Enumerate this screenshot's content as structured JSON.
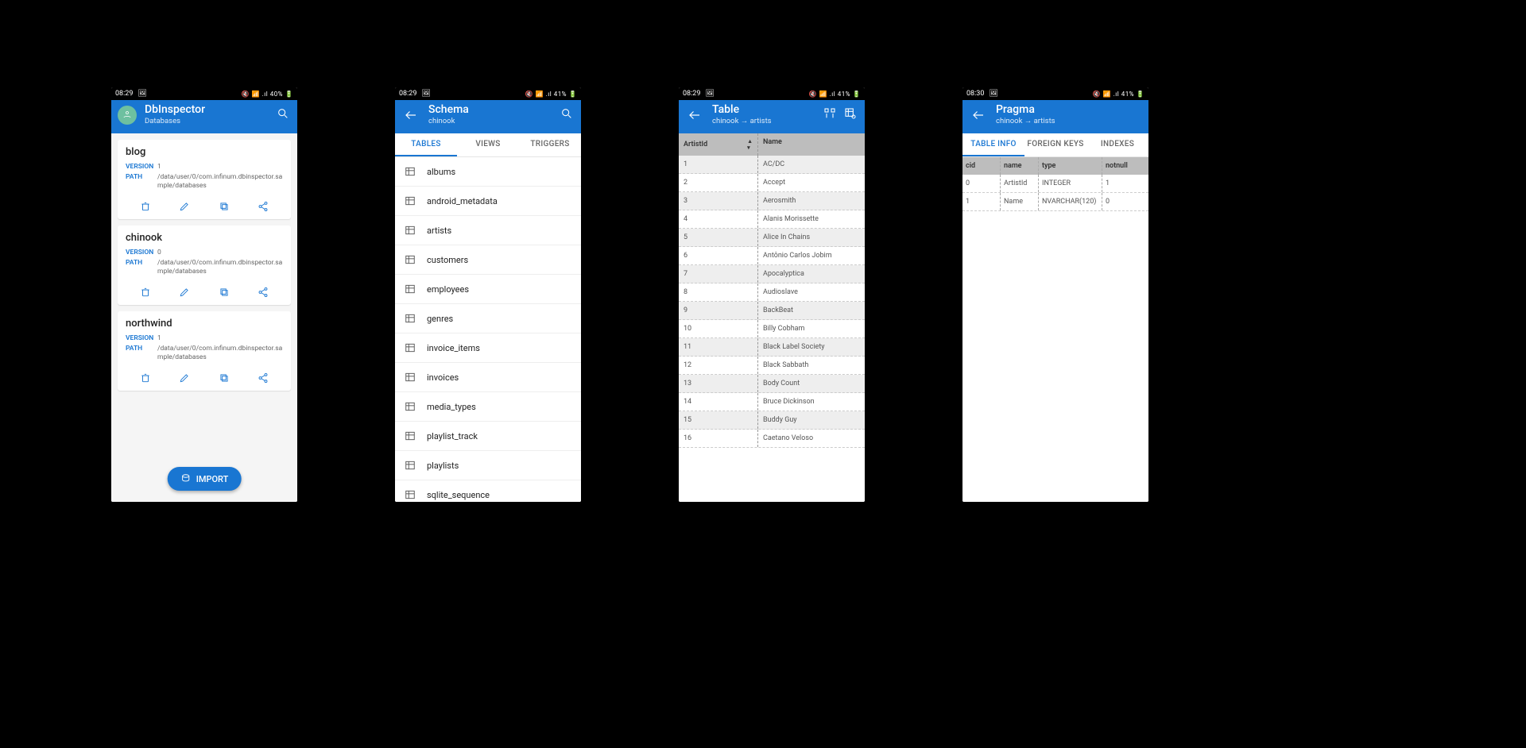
{
  "screens": {
    "s1": {
      "status": {
        "time": "08:29",
        "right": "🔇 📶 .ıl 40% 🔋"
      },
      "appbar": {
        "title": "DbInspector",
        "subtitle": "Databases"
      },
      "databases": [
        {
          "name": "blog",
          "version": [
            "VERSION",
            "1"
          ],
          "path": [
            "PATH",
            "/data/user/0/com.infinum.dbinspector.sample/databases"
          ]
        },
        {
          "name": "chinook",
          "version": [
            "VERSION",
            "0"
          ],
          "path": [
            "PATH",
            "/data/user/0/com.infinum.dbinspector.sample/databases"
          ]
        },
        {
          "name": "northwind",
          "version": [
            "VERSION",
            "1"
          ],
          "path": [
            "PATH",
            "/data/user/0/com.infinum.dbinspector.sample/databases"
          ]
        }
      ],
      "fab": "IMPORT"
    },
    "s2": {
      "status": {
        "time": "08:29",
        "right": "🔇 📶 .ıl 41% 🔋"
      },
      "appbar": {
        "title": "Schema",
        "subtitle": "chinook"
      },
      "tabs": [
        "TABLES",
        "VIEWS",
        "TRIGGERS"
      ],
      "active_tab": 0,
      "tables": [
        "albums",
        "android_metadata",
        "artists",
        "customers",
        "employees",
        "genres",
        "invoice_items",
        "invoices",
        "media_types",
        "playlist_track",
        "playlists",
        "sqlite_sequence"
      ]
    },
    "s3": {
      "status": {
        "time": "08:29",
        "right": "🔇 📶 .ıl 41% 🔋"
      },
      "appbar": {
        "title": "Table",
        "subtitle": "chinook → artists"
      },
      "columns": [
        "ArtistId",
        "Name"
      ],
      "rows": [
        [
          "1",
          "AC/DC"
        ],
        [
          "2",
          "Accept"
        ],
        [
          "3",
          "Aerosmith"
        ],
        [
          "4",
          "Alanis Morissette"
        ],
        [
          "5",
          "Alice In Chains"
        ],
        [
          "6",
          "Antônio Carlos Jobim"
        ],
        [
          "7",
          "Apocalyptica"
        ],
        [
          "8",
          "Audioslave"
        ],
        [
          "9",
          "BackBeat"
        ],
        [
          "10",
          "Billy Cobham"
        ],
        [
          "11",
          "Black Label Society"
        ],
        [
          "12",
          "Black Sabbath"
        ],
        [
          "13",
          "Body Count"
        ],
        [
          "14",
          "Bruce Dickinson"
        ],
        [
          "15",
          "Buddy Guy"
        ],
        [
          "16",
          "Caetano Veloso"
        ]
      ]
    },
    "s4": {
      "status": {
        "time": "08:30",
        "right": "🔇 📶 .ıl 41% 🔋"
      },
      "appbar": {
        "title": "Pragma",
        "subtitle": "chinook → artists"
      },
      "tabs": [
        "TABLE INFO",
        "FOREIGN KEYS",
        "INDEXES"
      ],
      "active_tab": 0,
      "columns": [
        "cid",
        "name",
        "type",
        "notnull"
      ],
      "rows": [
        [
          "0",
          "ArtistId",
          "INTEGER",
          "1"
        ],
        [
          "1",
          "Name",
          "NVARCHAR(120)",
          "0"
        ]
      ]
    }
  }
}
